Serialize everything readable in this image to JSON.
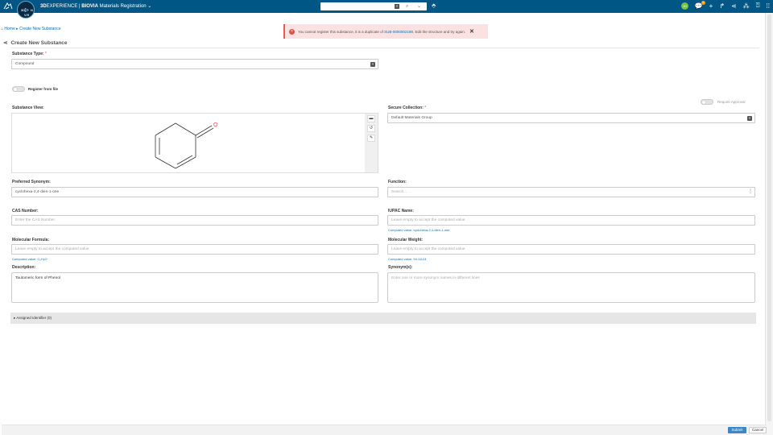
{
  "topbar": {
    "brand_bold": "3D",
    "brand_rest": "EXPERIENCE | ",
    "brand_app_bold": "BIOVIA",
    "brand_app": " Materials Registration",
    "user_initials": "JH",
    "notif_count": "3",
    "compass_labels": {
      "v": "V.R",
      "s": "3D",
      "n": "N"
    }
  },
  "breadcrumb": {
    "home": "Home",
    "sep": " ▸ ",
    "current": "Create New Substance"
  },
  "alert": {
    "prefix": "You cannot register this substance, it is a duplicate of ",
    "link": "SUB-0000002188",
    "suffix": ". Edit the structure and try again."
  },
  "page": {
    "title": "Create New Substance"
  },
  "form": {
    "substance_type": {
      "label": "Substance Type:",
      "req": "*",
      "value": "Compound"
    },
    "register_from_file": {
      "label": "Register from file"
    },
    "require_approval": {
      "label": "Require Approval"
    },
    "substance_view": {
      "label": "Substance View:"
    },
    "secure_collection": {
      "label": "Secure Collection:",
      "req": "*",
      "value": "Default Materials Group"
    },
    "preferred_synonym": {
      "label": "Preferred Synonym:",
      "value": "cyclohexa-2,4-dien-1-one"
    },
    "function": {
      "label": "Function:",
      "placeholder": "Search..."
    },
    "cas_number": {
      "label": "CAS Number:",
      "placeholder": "Enter the CAS Number"
    },
    "iupac_name": {
      "label": "IUPAC Name:",
      "placeholder": "Leave empty to accept the computed value",
      "computed": "Computed value: cyclohexa-2,4-dien-1-one"
    },
    "molecular_formula": {
      "label": "Molecular Formula:",
      "placeholder": "Leave empty to accept the computed value",
      "computed": "Computed value: C₆H₆O"
    },
    "molecular_weight": {
      "label": "Molecular Weight:",
      "placeholder": "Leave empty to accept the computed value",
      "computed": "Computed value: 94.11124"
    },
    "description": {
      "label": "Description:",
      "value": "Tautomeric form of Phenol"
    },
    "synonyms": {
      "label": "Synonym(s):",
      "placeholder": "Enter one or more synonym names in different lines"
    }
  },
  "accordion": {
    "label": "Assigned Identifier (0)"
  },
  "footer": {
    "submit": "Submit",
    "cancel": "Cancel"
  },
  "icons": {
    "ds_logo": "ds-logo-icon",
    "search": "search-icon",
    "tag": "tag-icon",
    "add": "plus-icon",
    "share": "share-icon",
    "network": "network-icon",
    "apps": "apps-icon",
    "help": "help-icon",
    "grid": "grid-icon",
    "error": "error-icon",
    "close": "close-icon"
  },
  "colors": {
    "topbar": "#005685",
    "link": "#0b6fb5",
    "error": "#d9534f",
    "alert_bg": "#fbe1e1",
    "submit": "#3a87c9"
  }
}
